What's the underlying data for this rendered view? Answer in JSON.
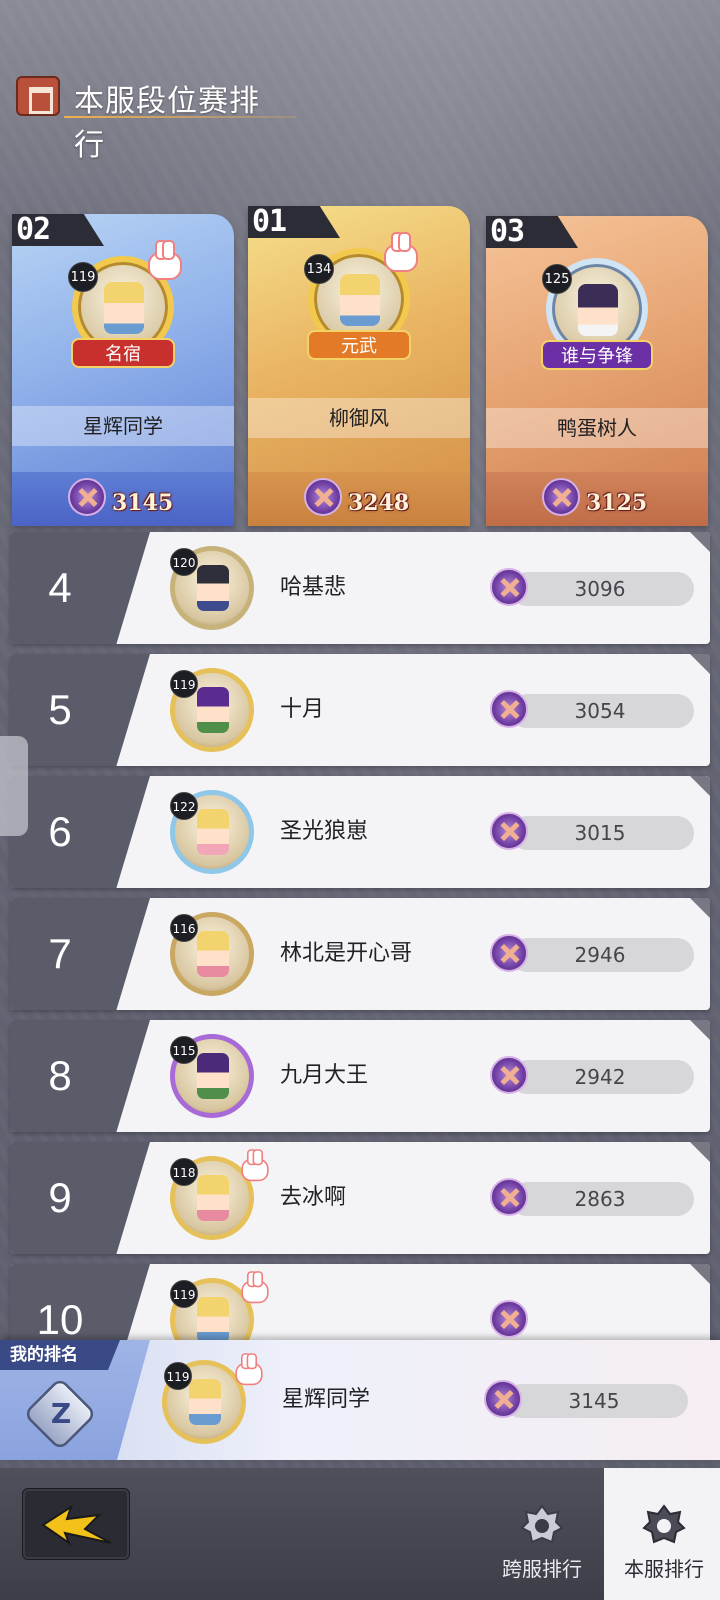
{
  "header": {
    "title": "本服段位赛排行",
    "icon": "leaderboard-icon"
  },
  "podium": [
    {
      "rank_label": "02",
      "level": "119",
      "title": "名宿",
      "name": "星辉同学",
      "score": "3145"
    },
    {
      "rank_label": "01",
      "level": "134",
      "title": "元武",
      "name": "柳御风",
      "score": "3248"
    },
    {
      "rank_label": "03",
      "level": "125",
      "title": "谁与争锋",
      "name": "鸭蛋树人",
      "score": "3125"
    }
  ],
  "rows": [
    {
      "rank": "4",
      "level": "120",
      "name": "哈基悲",
      "score": "3096"
    },
    {
      "rank": "5",
      "level": "119",
      "name": "十月",
      "score": "3054"
    },
    {
      "rank": "6",
      "level": "122",
      "name": "圣光狼崽",
      "score": "3015"
    },
    {
      "rank": "7",
      "level": "116",
      "name": "林北是开心哥",
      "score": "2946"
    },
    {
      "rank": "8",
      "level": "115",
      "name": "九月大王",
      "score": "2942"
    },
    {
      "rank": "9",
      "level": "118",
      "name": "去冰啊",
      "score": "2863"
    },
    {
      "rank": "10",
      "level": "119",
      "name": "",
      "score": ""
    }
  ],
  "my_rank": {
    "label": "我的排名",
    "badge_letter": "Z",
    "level": "119",
    "name": "星辉同学",
    "score": "3145"
  },
  "bottom_nav": {
    "tabs": [
      {
        "label": "跨服排行",
        "icon": "cross-server-crest-icon",
        "active": false
      },
      {
        "label": "本服排行",
        "icon": "local-server-crest-icon",
        "active": true
      }
    ],
    "back_icon": "back-arrow-icon"
  },
  "colors": {
    "rank_bg": "#5b5c6a",
    "gold": "#e6c15a",
    "my_rank_label": "#3a4a86"
  }
}
